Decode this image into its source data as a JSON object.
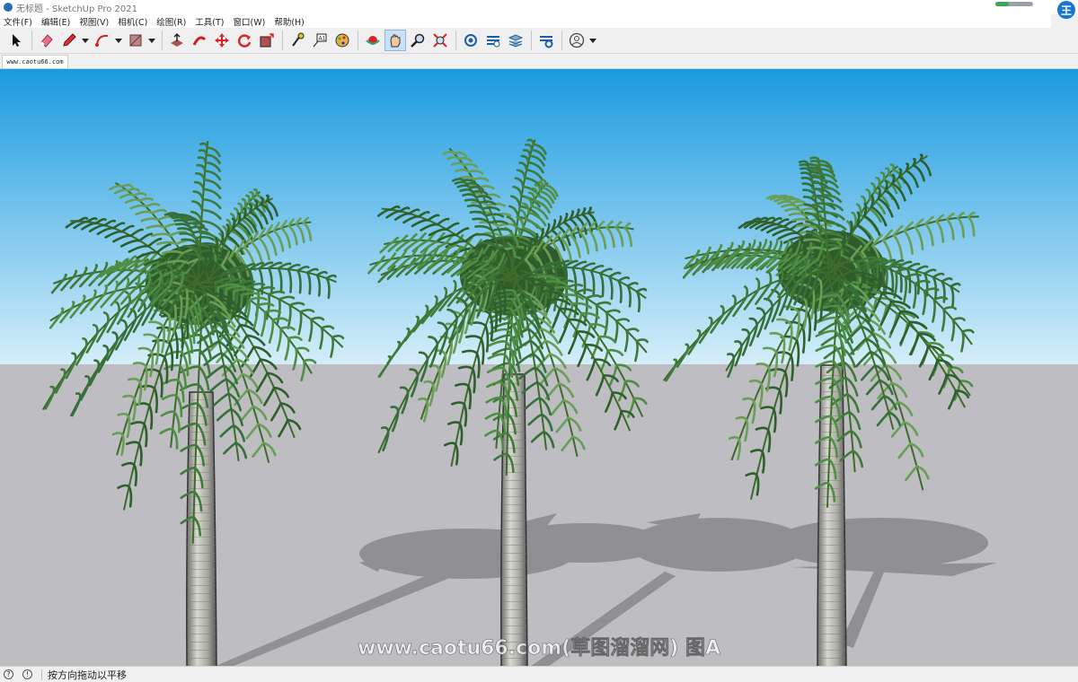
{
  "window": {
    "title": "无标题 - SketchUp Pro 2021",
    "avatar_letter": "王",
    "progress_fraction": 0.35
  },
  "menu": [
    "文件(F)",
    "编辑(E)",
    "视图(V)",
    "相机(C)",
    "绘图(R)",
    "工具(T)",
    "窗口(W)",
    "帮助(H)"
  ],
  "toolbar_icons": [
    "select-icon",
    "eraser-icon",
    "pencil-icon",
    "arc-icon",
    "rectangle-icon",
    "push-pull-icon",
    "follow-me-icon",
    "move-icon",
    "rotate-icon",
    "scale-icon",
    "tape-measure-icon",
    "text-icon",
    "paint-bucket-icon",
    "orbit-icon",
    "pan-icon",
    "zoom-icon",
    "zoom-extents-icon",
    "warehouse-icon",
    "extension-warehouse-icon",
    "layout-icon",
    "extension-manager-icon",
    "account-icon"
  ],
  "tab": {
    "label": "www.caotu66.com"
  },
  "scene": {
    "sky_top": "#1a9be0",
    "sky_bottom": "#d4eef9",
    "ground": "#bdbdc2",
    "watermark": "www.caotu66.com(草图溜溜网) 图A"
  },
  "status": {
    "message": "按方向拖动以平移"
  }
}
